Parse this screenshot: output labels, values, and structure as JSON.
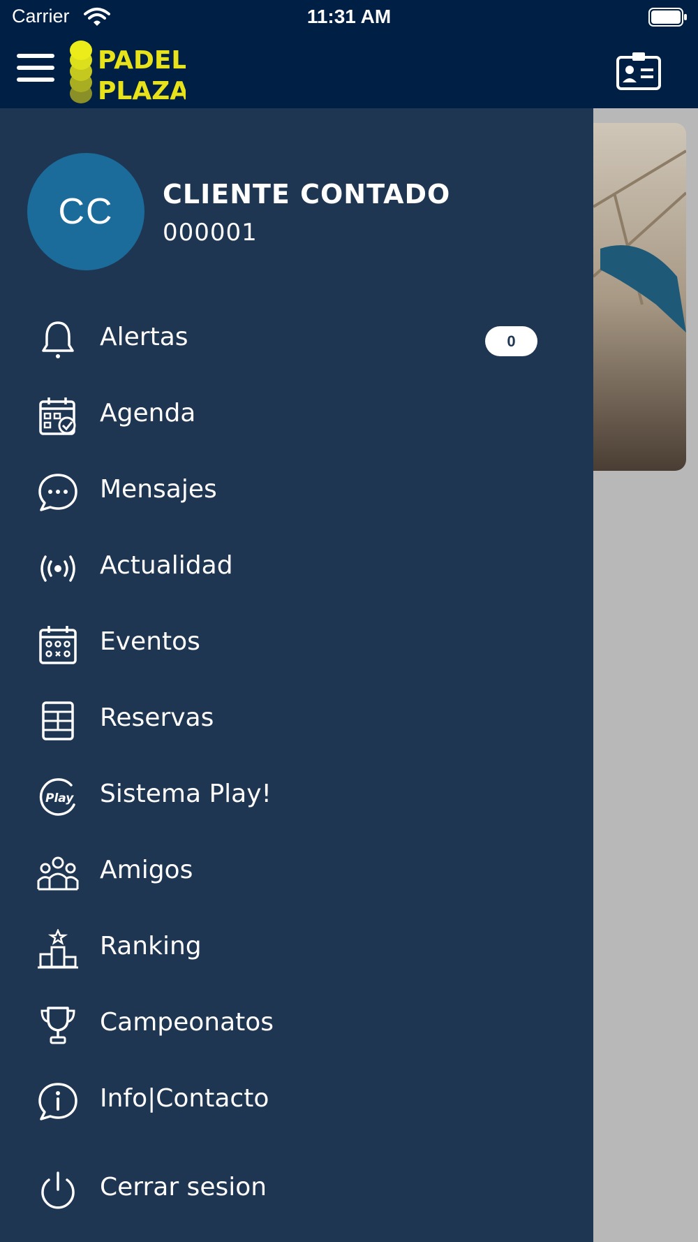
{
  "status_bar": {
    "carrier": "Carrier",
    "time": "11:31 AM"
  },
  "header": {
    "logo_line1": "PADEL",
    "logo_line2": "PLAZA",
    "menu_icon": "hamburger-icon",
    "card_icon": "contact-card-icon"
  },
  "colors": {
    "header_bg": "#001f45",
    "drawer_bg": "#1f3652",
    "avatar_bg": "#1b6b9b",
    "logo_yellow": "#e8e21b"
  },
  "user": {
    "initials": "CC",
    "name": "CLIENTE CONTADO",
    "code": "000001"
  },
  "menu": [
    {
      "label": "Alertas",
      "icon": "bell-icon",
      "badge": "0"
    },
    {
      "label": "Agenda",
      "icon": "calendar-check-icon"
    },
    {
      "label": "Mensajes",
      "icon": "chat-bubble-icon"
    },
    {
      "label": "Actualidad",
      "icon": "broadcast-icon"
    },
    {
      "label": "Eventos",
      "icon": "calendar-grid-icon"
    },
    {
      "label": "Reservas",
      "icon": "court-icon"
    },
    {
      "label": "Sistema Play!",
      "icon": "play-icon"
    },
    {
      "label": "Amigos",
      "icon": "friends-icon"
    },
    {
      "label": "Ranking",
      "icon": "podium-icon"
    },
    {
      "label": "Campeonatos",
      "icon": "trophy-icon"
    },
    {
      "label": "Info|Contacto",
      "icon": "info-chat-icon"
    },
    {
      "label": "Cerrar sesion",
      "icon": "power-icon"
    }
  ]
}
